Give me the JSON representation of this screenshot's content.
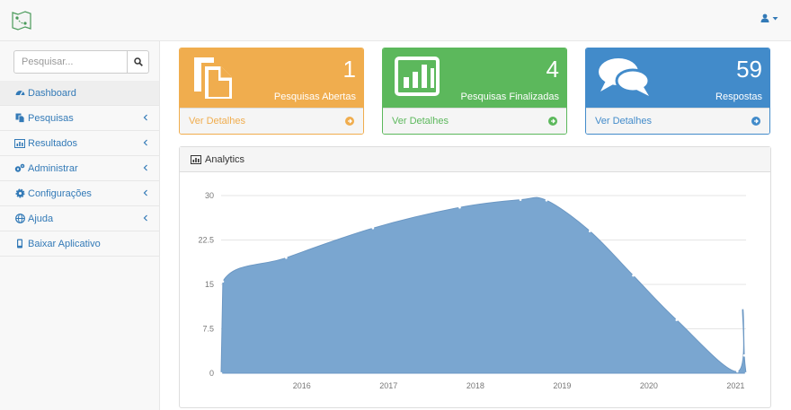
{
  "header": {
    "logo_icon": "map-icon",
    "user_icon": "user-icon",
    "dropdown_icon": "caret-down-icon"
  },
  "search": {
    "placeholder": "Pesquisar..."
  },
  "sidebar": {
    "items": [
      {
        "label": "Dashboard",
        "icon": "dashboard-icon",
        "active": true,
        "chevron": false
      },
      {
        "label": "Pesquisas",
        "icon": "files-icon",
        "active": false,
        "chevron": true
      },
      {
        "label": "Resultados",
        "icon": "bar-chart-icon",
        "active": false,
        "chevron": true
      },
      {
        "label": "Administrar",
        "icon": "cogs-icon",
        "active": false,
        "chevron": true
      },
      {
        "label": "Configurações",
        "icon": "gear-icon",
        "active": false,
        "chevron": true
      },
      {
        "label": "Ajuda",
        "icon": "globe-icon",
        "active": false,
        "chevron": true
      },
      {
        "label": "Baixar Aplicativo",
        "icon": "mobile-icon",
        "active": false,
        "chevron": false
      }
    ]
  },
  "cards": [
    {
      "value": "1",
      "label": "Pesquisas Abertas",
      "link": "Ver Detalhes",
      "icon": "files-icon",
      "color": "#f0ad4e"
    },
    {
      "value": "4",
      "label": "Pesquisas Finalizadas",
      "link": "Ver Detalhes",
      "icon": "bar-chart-icon",
      "color": "#5cb85c"
    },
    {
      "value": "59",
      "label": "Respostas",
      "link": "Ver Detalhes",
      "icon": "comments-icon",
      "color": "#428bca"
    }
  ],
  "panel": {
    "title": "Analytics"
  },
  "chart_data": {
    "type": "area",
    "x": [
      2015.25,
      2015.27,
      2016,
      2017,
      2018,
      2018.7,
      2019.0,
      2019.5,
      2020,
      2020.5,
      2021.2,
      2021.26,
      2021.28,
      2021.3
    ],
    "y": [
      0,
      15.5,
      19.5,
      24.5,
      28,
      29.3,
      29.2,
      24,
      16.5,
      9,
      0.3,
      11,
      3,
      0
    ],
    "x_ticks": [
      "2016",
      "2017",
      "2018",
      "2019",
      "2020",
      "2021"
    ],
    "y_ticks": [
      "0",
      "7.5",
      "15",
      "22.5",
      "30"
    ],
    "xlim": [
      2015.25,
      2021.3
    ],
    "ylim": [
      0,
      30
    ],
    "grid": true,
    "color": "#7aa6d0"
  }
}
